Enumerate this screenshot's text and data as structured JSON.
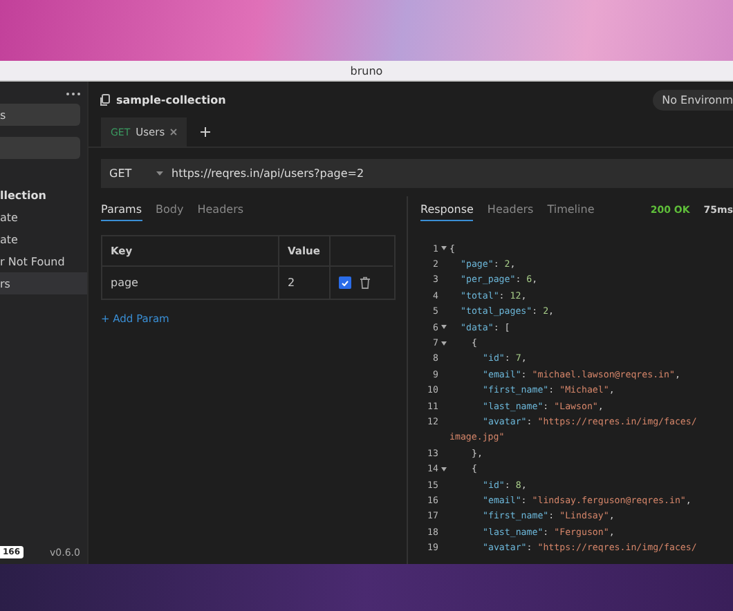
{
  "window": {
    "title": "bruno"
  },
  "sidebar": {
    "search": {
      "value": "s"
    },
    "collection": "llection",
    "items": [
      {
        "label": "ate",
        "selected": false
      },
      {
        "label": "ate",
        "selected": false
      },
      {
        "label": "r Not Found",
        "selected": false
      },
      {
        "label": "rs",
        "selected": true
      }
    ],
    "footer": {
      "badge": "166",
      "version": "v0.6.0"
    }
  },
  "collection_header": {
    "name": "sample-collection",
    "environment": "No Environm"
  },
  "request_tabs": [
    {
      "method": "GET",
      "name": "Users",
      "selected": true
    }
  ],
  "url_bar": {
    "method": "GET",
    "url": "https://reqres.in/api/users?page=2"
  },
  "request_panel": {
    "tabs": [
      {
        "label": "Params",
        "selected": true
      },
      {
        "label": "Body",
        "selected": false
      },
      {
        "label": "Headers",
        "selected": false
      }
    ],
    "columns": [
      "Key",
      "Value"
    ],
    "params": [
      {
        "key": "page",
        "value": "2",
        "enabled": true
      }
    ],
    "add_param": "+ Add Param"
  },
  "response_panel": {
    "tabs": [
      {
        "label": "Response",
        "selected": true
      },
      {
        "label": "Headers",
        "selected": false
      },
      {
        "label": "Timeline",
        "selected": false
      }
    ],
    "status": "200 OK",
    "time": "75ms",
    "lines": [
      {
        "number": "1",
        "foldable": true,
        "tokens": [
          {
            "kind": "punct",
            "text": "{"
          }
        ]
      },
      {
        "number": "2",
        "foldable": false,
        "tokens": [
          {
            "kind": "key",
            "text": "\"page\""
          },
          {
            "kind": "punct",
            "text": ": "
          },
          {
            "kind": "number",
            "text": "2"
          },
          {
            "kind": "punct",
            "text": ","
          }
        ]
      },
      {
        "number": "3",
        "foldable": false,
        "tokens": [
          {
            "kind": "key",
            "text": "\"per_page\""
          },
          {
            "kind": "punct",
            "text": ": "
          },
          {
            "kind": "number",
            "text": "6"
          },
          {
            "kind": "punct",
            "text": ","
          }
        ]
      },
      {
        "number": "4",
        "foldable": false,
        "tokens": [
          {
            "kind": "key",
            "text": "\"total\""
          },
          {
            "kind": "punct",
            "text": ": "
          },
          {
            "kind": "number",
            "text": "12"
          },
          {
            "kind": "punct",
            "text": ","
          }
        ]
      },
      {
        "number": "5",
        "foldable": false,
        "tokens": [
          {
            "kind": "key",
            "text": "\"total_pages\""
          },
          {
            "kind": "punct",
            "text": ": "
          },
          {
            "kind": "number",
            "text": "2"
          },
          {
            "kind": "punct",
            "text": ","
          }
        ]
      },
      {
        "number": "6",
        "foldable": true,
        "tokens": [
          {
            "kind": "key",
            "text": "\"data\""
          },
          {
            "kind": "punct",
            "text": ": ["
          }
        ]
      },
      {
        "number": "7",
        "foldable": true,
        "tokens": [
          {
            "kind": "punct",
            "text": "{"
          }
        ]
      },
      {
        "number": "8",
        "foldable": false,
        "tokens": [
          {
            "kind": "key",
            "text": "\"id\""
          },
          {
            "kind": "punct",
            "text": ": "
          },
          {
            "kind": "number",
            "text": "7"
          },
          {
            "kind": "punct",
            "text": ","
          }
        ]
      },
      {
        "number": "9",
        "foldable": false,
        "tokens": [
          {
            "kind": "key",
            "text": "\"email\""
          },
          {
            "kind": "punct",
            "text": ": "
          },
          {
            "kind": "string",
            "text": "\"michael.lawson@reqres.in\""
          },
          {
            "kind": "punct",
            "text": ","
          }
        ]
      },
      {
        "number": "10",
        "foldable": false,
        "tokens": [
          {
            "kind": "key",
            "text": "\"first_name\""
          },
          {
            "kind": "punct",
            "text": ": "
          },
          {
            "kind": "string",
            "text": "\"Michael\""
          },
          {
            "kind": "punct",
            "text": ","
          }
        ]
      },
      {
        "number": "11",
        "foldable": false,
        "tokens": [
          {
            "kind": "key",
            "text": "\"last_name\""
          },
          {
            "kind": "punct",
            "text": ": "
          },
          {
            "kind": "string",
            "text": "\"Lawson\""
          },
          {
            "kind": "punct",
            "text": ","
          }
        ]
      },
      {
        "number": "12",
        "foldable": false,
        "tokens": [
          {
            "kind": "key",
            "text": "\"avatar\""
          },
          {
            "kind": "punct",
            "text": ": "
          },
          {
            "kind": "string",
            "text": "\"https://reqres.in/img/faces/"
          }
        ]
      },
      {
        "foldable": false,
        "tokens": [
          {
            "kind": "string",
            "text": "image.jpg\""
          }
        ]
      },
      {
        "number": "13",
        "foldable": false,
        "tokens": [
          {
            "kind": "punct",
            "text": "},"
          }
        ]
      },
      {
        "number": "14",
        "foldable": true,
        "tokens": [
          {
            "kind": "punct",
            "text": "{"
          }
        ]
      },
      {
        "number": "15",
        "foldable": false,
        "tokens": [
          {
            "kind": "key",
            "text": "\"id\""
          },
          {
            "kind": "punct",
            "text": ": "
          },
          {
            "kind": "number",
            "text": "8"
          },
          {
            "kind": "punct",
            "text": ","
          }
        ]
      },
      {
        "number": "16",
        "foldable": false,
        "tokens": [
          {
            "kind": "key",
            "text": "\"email\""
          },
          {
            "kind": "punct",
            "text": ": "
          },
          {
            "kind": "string",
            "text": "\"lindsay.ferguson@reqres.in\""
          },
          {
            "kind": "punct",
            "text": ","
          }
        ]
      },
      {
        "number": "17",
        "foldable": false,
        "tokens": [
          {
            "kind": "key",
            "text": "\"first_name\""
          },
          {
            "kind": "punct",
            "text": ": "
          },
          {
            "kind": "string",
            "text": "\"Lindsay\""
          },
          {
            "kind": "punct",
            "text": ","
          }
        ]
      },
      {
        "number": "18",
        "foldable": false,
        "tokens": [
          {
            "kind": "key",
            "text": "\"last_name\""
          },
          {
            "kind": "punct",
            "text": ": "
          },
          {
            "kind": "string",
            "text": "\"Ferguson\""
          },
          {
            "kind": "punct",
            "text": ","
          }
        ]
      },
      {
        "number": "19",
        "foldable": false,
        "tokens": [
          {
            "kind": "key",
            "text": "\"avatar\""
          },
          {
            "kind": "punct",
            "text": ": "
          },
          {
            "kind": "string",
            "text": "\"https://reqres.in/img/faces/"
          }
        ]
      }
    ]
  }
}
